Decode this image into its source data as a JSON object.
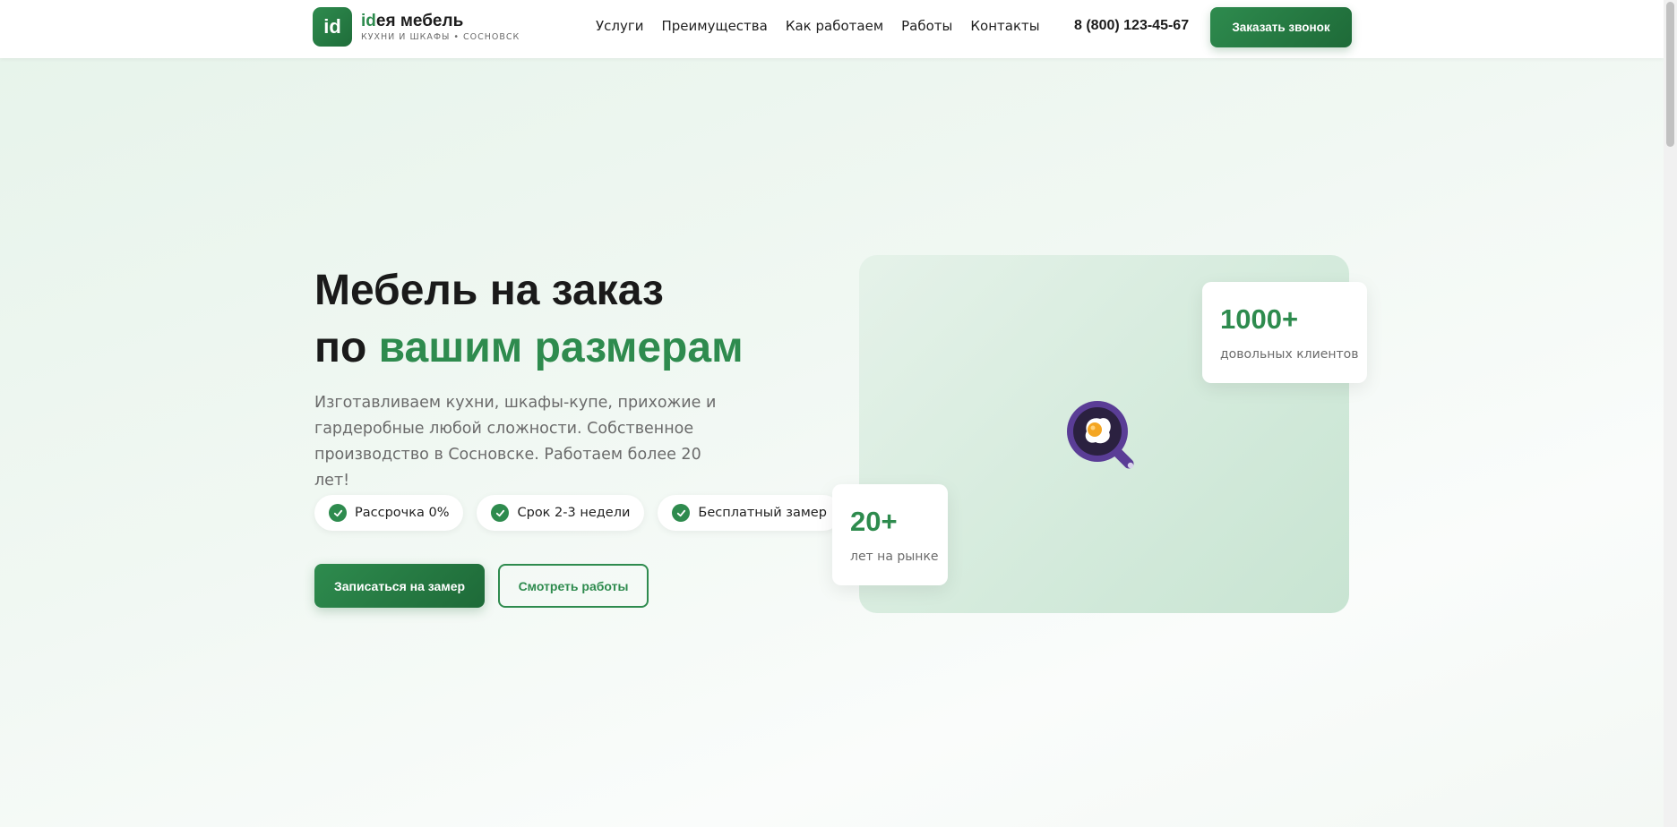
{
  "header": {
    "logo_mark": "id",
    "logo_name_accent": "id",
    "logo_name_rest": "ея мебель",
    "logo_tagline": "КУХНИ И ШКАФЫ • СОСНОВСК",
    "nav": [
      "Услуги",
      "Преимущества",
      "Как работаем",
      "Работы",
      "Контакты"
    ],
    "phone": "8 (800) 123-45-67",
    "cta_label": "Заказать звонок"
  },
  "hero": {
    "title_line1": "Мебель на заказ",
    "title_line2_plain": "по ",
    "title_line2_accent": "вашим размерам",
    "description": "Изготавливаем кухни, шкафы-купе, прихожие и гардеробные любой сложности. Собственное производство в Сосновске. Работаем более 20 лет!",
    "chips": [
      "Рассрочка 0%",
      "Срок 2-3 недели",
      "Бесплатный замер"
    ],
    "primary_button": "Записаться на замер",
    "secondary_button": "Смотреть работы"
  },
  "stats": [
    {
      "value": "1000+",
      "label": "довольных клиентов"
    },
    {
      "value": "20+",
      "label": "лет на рынке"
    }
  ],
  "colors": {
    "accent": "#2e8b4e",
    "accent_dark": "#1e6a38",
    "text": "#1c1c1c",
    "muted": "#6b6b6b"
  },
  "icons": {
    "hero_illustration": "frying-pan-egg-icon",
    "chip_icon": "check-circle-icon"
  }
}
